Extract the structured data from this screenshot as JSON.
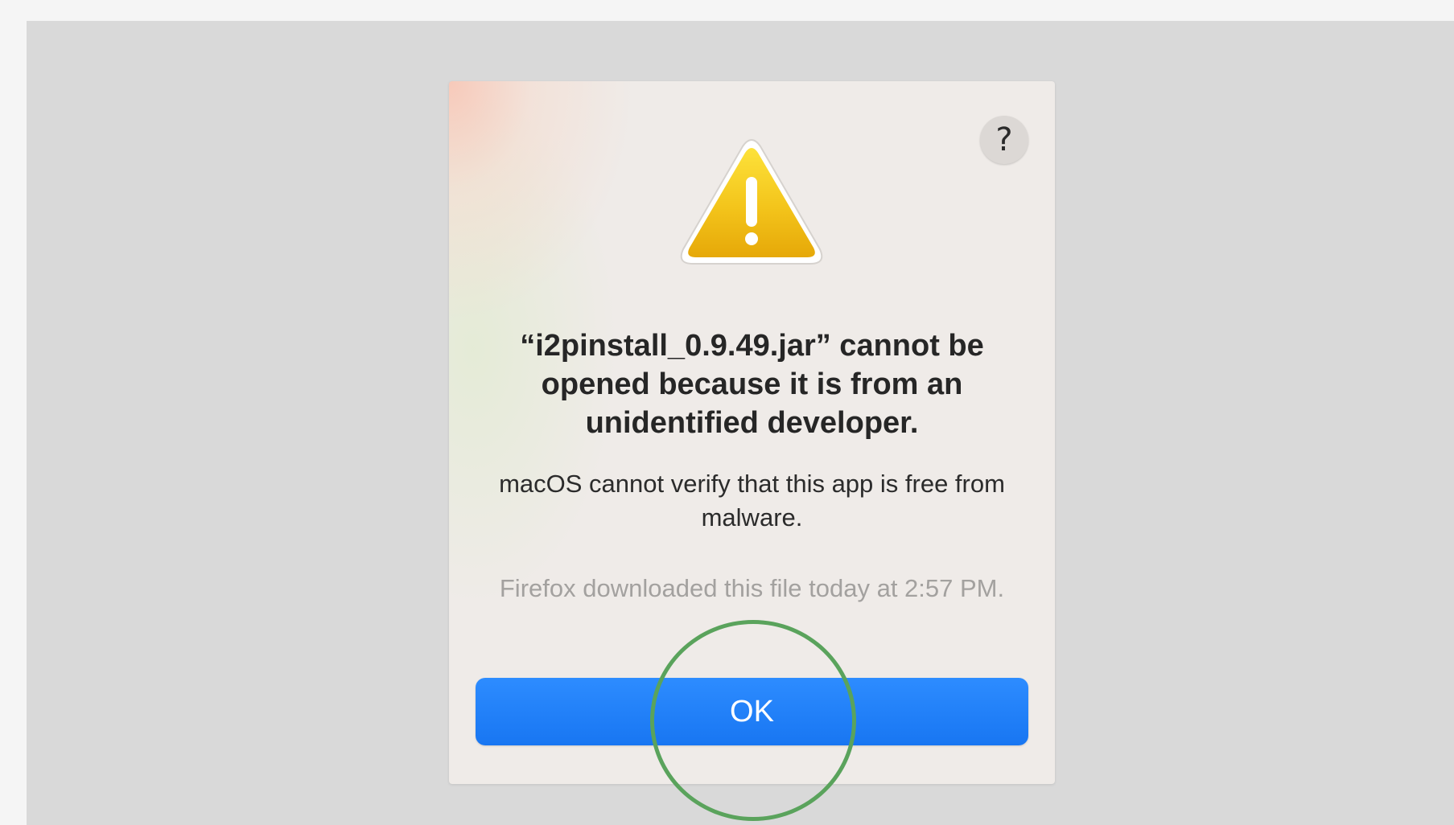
{
  "dialog": {
    "help_label": "?",
    "icon": "warning-triangle-icon",
    "title": "“i2pinstall_0.9.49.jar” cannot be opened because it is from an unidentified developer.",
    "message": "macOS cannot verify that this app is free from malware.",
    "download_info": "Firefox downloaded this file today at 2:57 PM.",
    "ok_label": "OK"
  },
  "colors": {
    "accent_button": "#1a7cf5",
    "warning_yellow": "#f2c41e",
    "annotation_green": "#5aa35c"
  }
}
